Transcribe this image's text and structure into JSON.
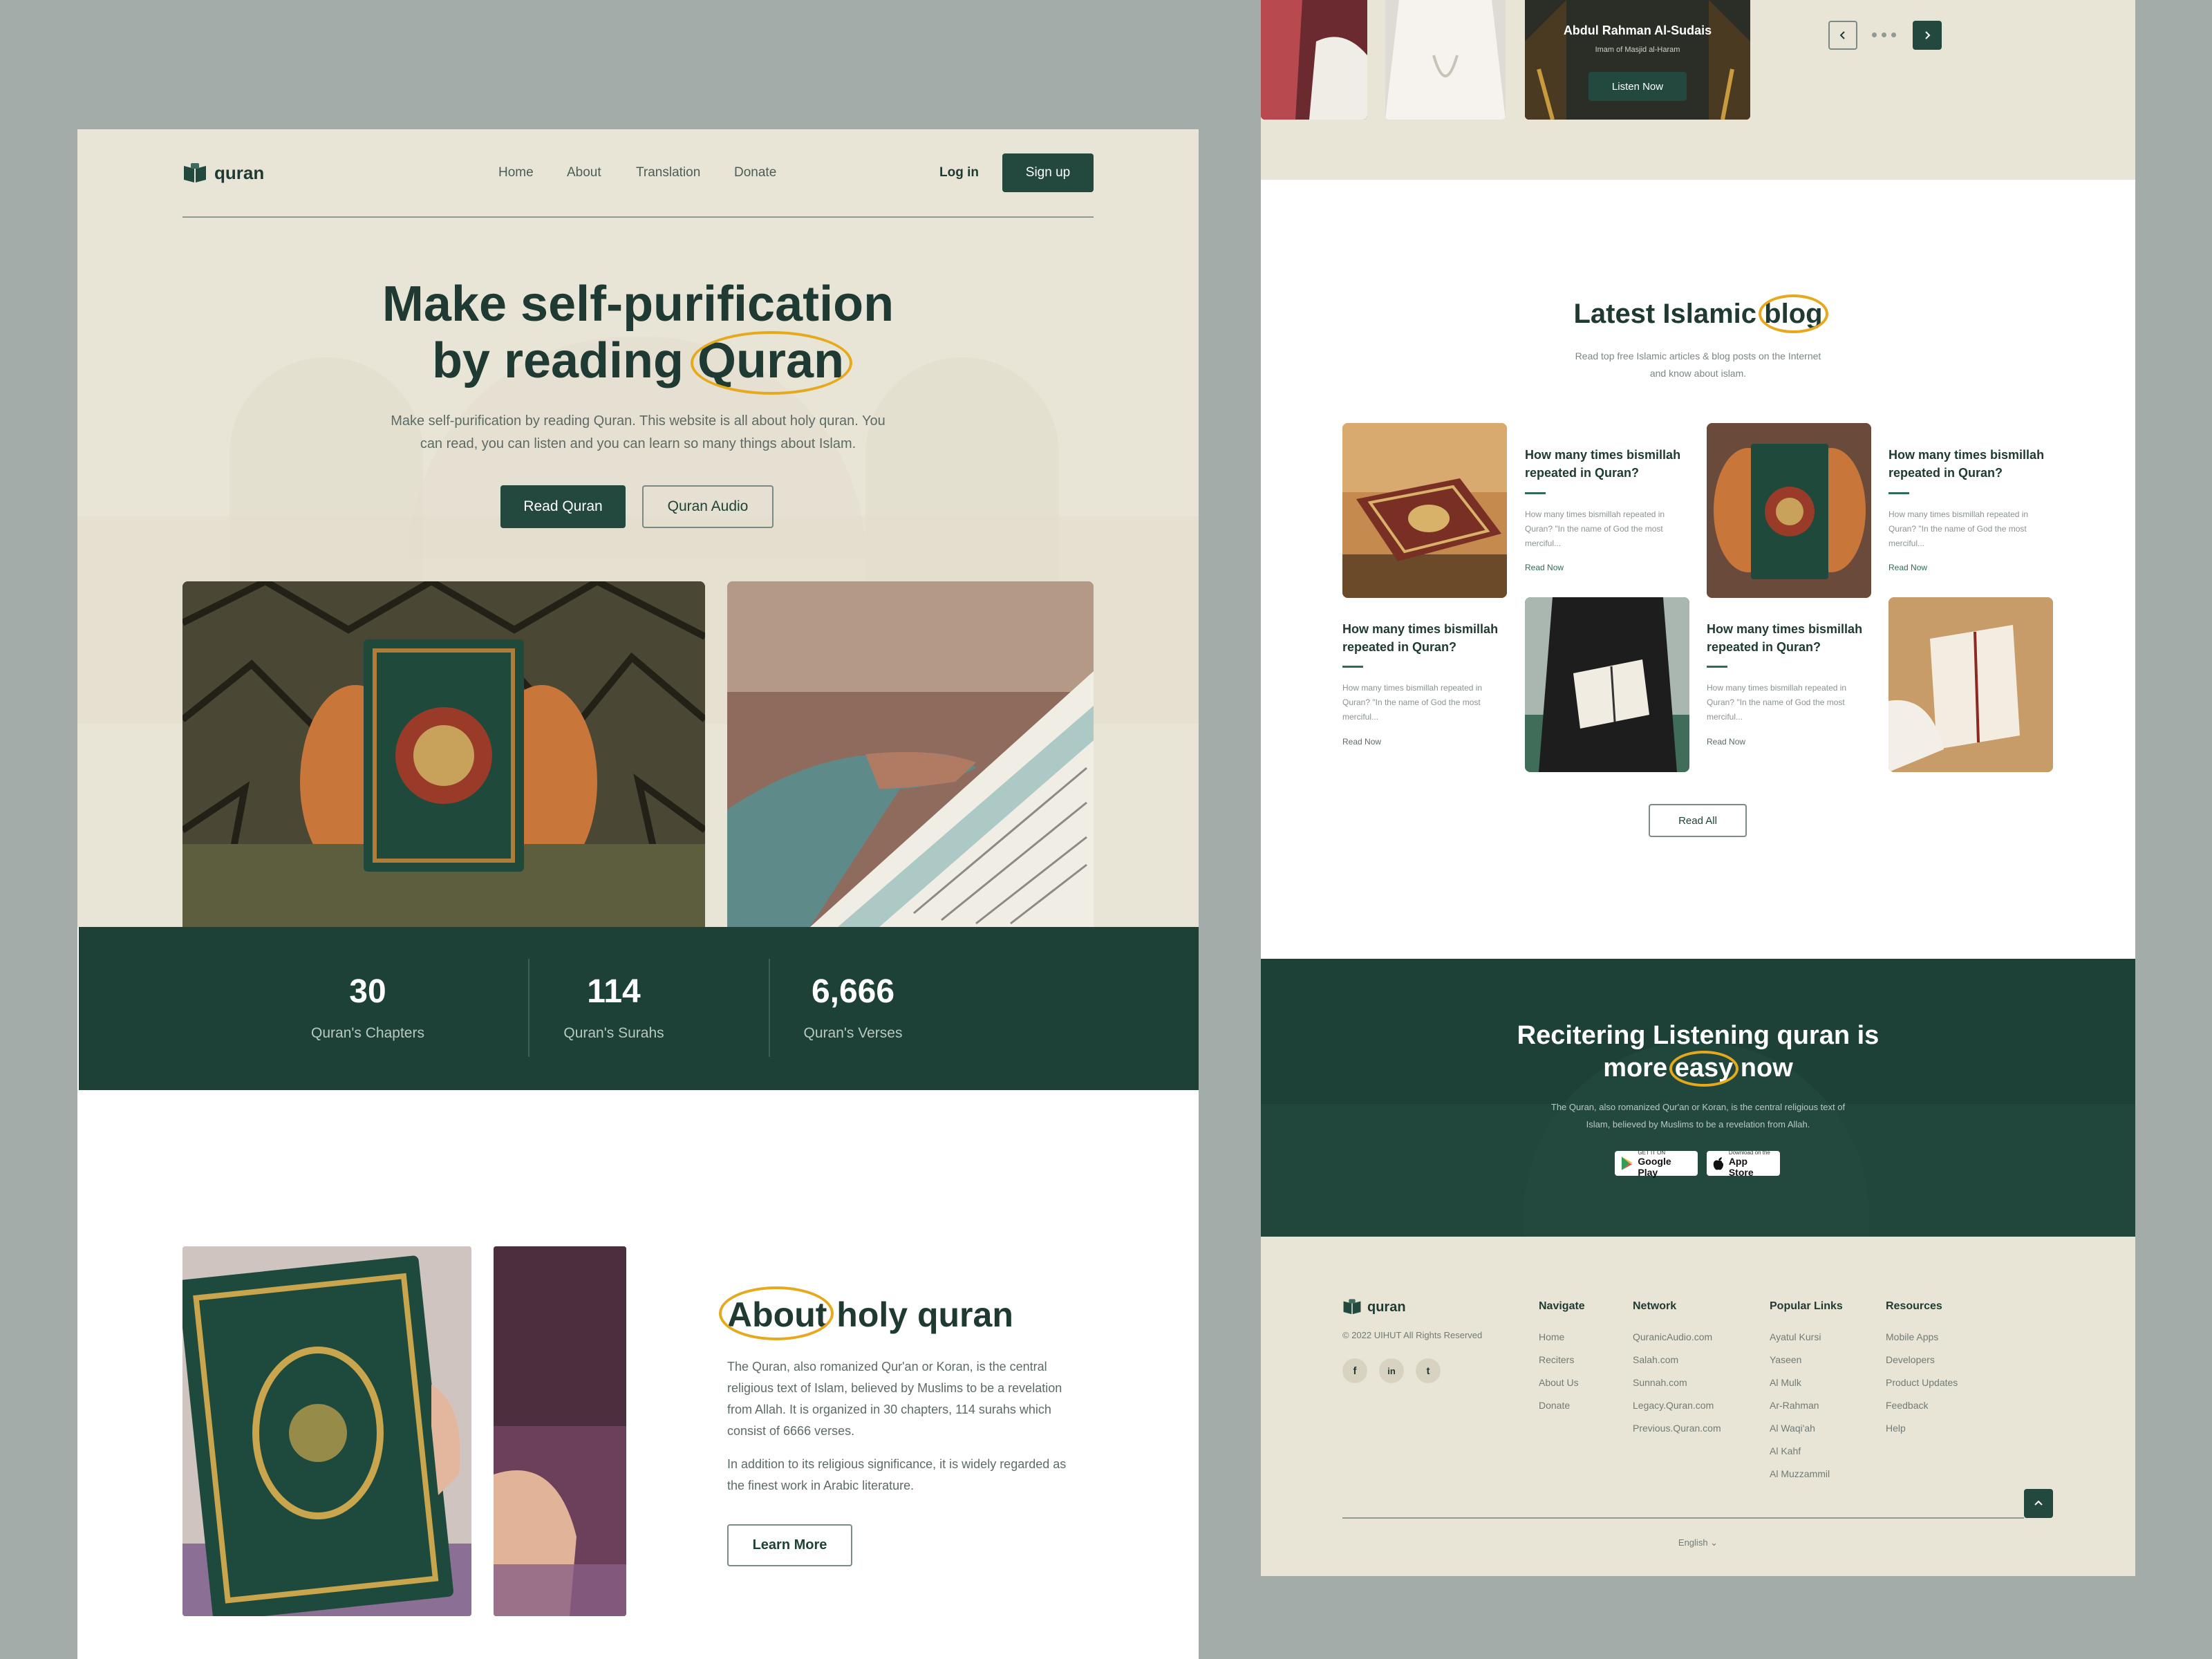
{
  "brand": {
    "name": "quran"
  },
  "nav": {
    "links": [
      "Home",
      "About",
      "Translation",
      "Donate"
    ],
    "login": "Log in",
    "signup": "Sign up"
  },
  "hero": {
    "title_line1": "Make self-purification",
    "title_line2_prefix": "by reading",
    "title_line2_highlight": "Quran",
    "subtitle_line1": "Make self-purification by reading Quran. This website is all about holy quran. You",
    "subtitle_line2": "can read, you can listen and you can learn so many things about Islam.",
    "primary_button": "Read Quran",
    "secondary_button": "Quran Audio"
  },
  "stats": [
    {
      "value": "30",
      "label": "Quran's Chapters"
    },
    {
      "value": "114",
      "label": "Quran's Surahs"
    },
    {
      "value": "6,666",
      "label": "Quran's Verses"
    }
  ],
  "about": {
    "title_highlight": "About",
    "title_rest": "holy quran",
    "para1_lines": [
      "The Quran, also romanized Qur'an or Koran, is the central",
      "religious text of Islam, believed by Muslims to be a revelation",
      "from Allah. It is organized in 30 chapters, 114 surahs which",
      "consist of 6666 verses."
    ],
    "para2_lines": [
      "In addition to its religious significance, it is widely regarded as",
      "the finest work in Arabic literature."
    ],
    "button": "Learn More"
  },
  "reciter": {
    "name": "Abdul Rahman Al-Sudais",
    "role": "Imam of Masjid al-Haram",
    "button": "Listen Now",
    "prev_icon": "chevron-left-icon",
    "next_icon": "chevron-right-icon"
  },
  "blog": {
    "title_prefix": "Latest Islamic",
    "title_highlight": "blog",
    "subtitle_line1": "Read top free Islamic articles & blog posts on the Internet",
    "subtitle_line2": "and know about islam.",
    "posts": [
      {
        "title_line1": "How many times bismillah",
        "title_line2": "repeated in Quran?",
        "desc_line1": "How many times bismillah repeated in",
        "desc_line2": "Quran? \"In the name of God the most",
        "desc_line3": "merciful...",
        "link": "Read Now"
      },
      {
        "title_line1": "How many times bismillah",
        "title_line2": "repeated in Quran?",
        "desc_line1": "How many times bismillah repeated in",
        "desc_line2": "Quran? \"In the name of God the most",
        "desc_line3": "merciful...",
        "link": "Read Now"
      },
      {
        "title_line1": "How many times bismillah",
        "title_line2": "repeated in Quran?",
        "desc_line1": "How many times bismillah repeated in",
        "desc_line2": "Quran? \"In the name of God the most",
        "desc_line3": "merciful...",
        "link": "Read Now"
      },
      {
        "title_line1": "How many times bismillah",
        "title_line2": "repeated in Quran?",
        "desc_line1": "How many times bismillah repeated in",
        "desc_line2": "Quran? \"In the name of God the most",
        "desc_line3": "merciful...",
        "link": "Read Now"
      }
    ],
    "read_all": "Read All"
  },
  "app": {
    "title_line1": "Recitering Listening quran is",
    "title_line2_prefix": "more",
    "title_line2_highlight": "easy",
    "title_line2_suffix": "now",
    "desc_line1": "The Quran, also romanized Qur'an or Koran, is the central religious text of",
    "desc_line2": "Islam, believed by Muslims to be a revelation from Allah.",
    "google_small": "GET IT ON",
    "google_big": "Google Play",
    "apple_small": "Download on the",
    "apple_big": "App Store"
  },
  "footer": {
    "copyright": "© 2022 UIHUT All Rights Reserved",
    "social": [
      "f",
      "in",
      "t"
    ],
    "columns": [
      {
        "heading": "Navigate",
        "items": [
          "Home",
          "Reciters",
          "About Us",
          "Donate"
        ]
      },
      {
        "heading": "Network",
        "items": [
          "QuranicAudio.com",
          "Salah.com",
          "Sunnah.com",
          "Legacy.Quran.com",
          "Previous.Quran.com"
        ]
      },
      {
        "heading": "Popular Links",
        "items": [
          "Ayatul Kursi",
          "Yaseen",
          "Al Mulk",
          "Ar-Rahman",
          "Al Waqi'ah",
          "Al Kahf",
          "Al Muzzammil"
        ]
      },
      {
        "heading": "Resources",
        "items": [
          "Mobile Apps",
          "Developers",
          "Product Updates",
          "Feedback",
          "Help"
        ]
      }
    ],
    "language": "English"
  },
  "colors": {
    "primary": "#1d4137",
    "accent": "#e6a91c",
    "cream": "#e9e5d6"
  }
}
